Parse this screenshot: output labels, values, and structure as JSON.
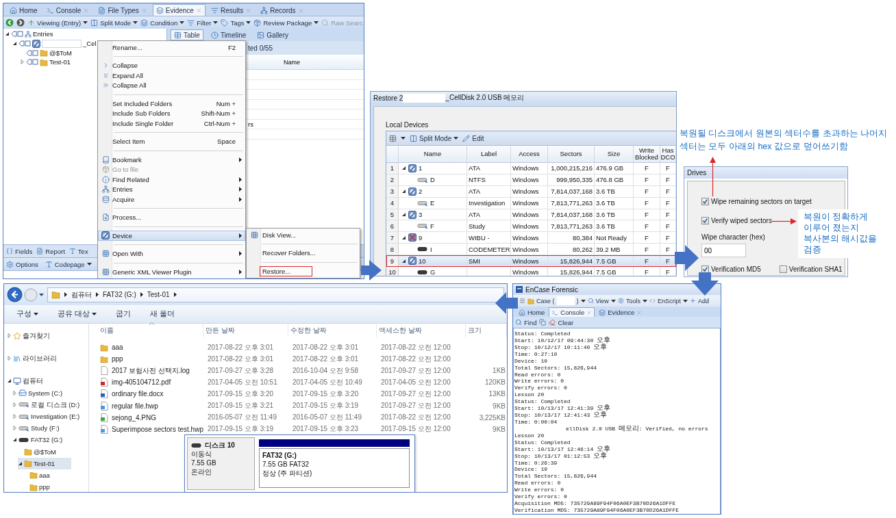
{
  "encase_window": {
    "tabs": [
      {
        "label": "Home",
        "selected": false,
        "closable": false
      },
      {
        "label": "Console",
        "selected": false,
        "closable": true
      },
      {
        "label": "File Types",
        "selected": false,
        "closable": true
      },
      {
        "label": "Evidence",
        "selected": true,
        "closable": true
      },
      {
        "label": "Results",
        "selected": false,
        "closable": true
      },
      {
        "label": "Records",
        "selected": false,
        "closable": true
      }
    ],
    "toolbar": [
      {
        "label": "Viewing (Entry)",
        "dropdown": true,
        "disabled": false
      },
      {
        "label": "Split Mode",
        "dropdown": true,
        "disabled": false
      },
      {
        "label": "Condition",
        "dropdown": true,
        "disabled": false
      },
      {
        "label": "Filter",
        "dropdown": true,
        "disabled": false
      },
      {
        "label": "Tags",
        "dropdown": true,
        "disabled": false
      },
      {
        "label": "Review Package",
        "dropdown": true,
        "disabled": false
      },
      {
        "label": "Raw Searc",
        "dropdown": false,
        "disabled": true
      }
    ],
    "tree": [
      {
        "label": "Entries",
        "kind": "root",
        "expandable": true,
        "expanded": true,
        "redacted": false,
        "children": [
          {
            "label": "_Cel",
            "kind": "device",
            "expandable": true,
            "expanded": true,
            "redacted": true,
            "children": [
              {
                "label": "@$ToM",
                "kind": "folder",
                "expandable": false,
                "redacted": false
              },
              {
                "label": "Test-01",
                "kind": "folder",
                "expandable": true,
                "expanded": false,
                "redacted": false
              }
            ]
          }
        ]
      }
    ],
    "view_tabs": [
      {
        "label": "Table",
        "selected": true
      },
      {
        "label": "Timeline",
        "selected": false
      },
      {
        "label": "Gallery",
        "selected": false
      }
    ],
    "status_fragment": "ted 0/55",
    "column_header": "Name",
    "cell_fragment": "rs",
    "bottom_tabs": [
      {
        "label": "Fields"
      },
      {
        "label": "Report"
      },
      {
        "label": "Tex"
      }
    ],
    "bottom_toolbar": [
      {
        "label": "Options",
        "dropdown": false
      },
      {
        "label": "Codepage",
        "dropdown": true
      }
    ],
    "context_menu": [
      {
        "kind": "item",
        "label": "Rename...",
        "shortcut": "F2",
        "submenu": false,
        "disabled": false,
        "selected": false
      },
      {
        "kind": "separator"
      },
      {
        "kind": "item",
        "label": "Collapse",
        "submenu": false,
        "disabled": false,
        "selected": false
      },
      {
        "kind": "item",
        "label": "Expand All",
        "submenu": false,
        "disabled": false,
        "selected": false
      },
      {
        "kind": "item",
        "label": "Collapse All",
        "submenu": false,
        "disabled": false,
        "selected": false
      },
      {
        "kind": "separator"
      },
      {
        "kind": "item",
        "label": "Set Included Folders",
        "shortcut": "Num +",
        "submenu": false,
        "disabled": false,
        "selected": false
      },
      {
        "kind": "item",
        "label": "Include Sub Folders",
        "shortcut": "Shift-Num +",
        "submenu": false,
        "disabled": false,
        "selected": false
      },
      {
        "kind": "item",
        "label": "Include Single Folder",
        "shortcut": "Ctrl-Num +",
        "submenu": false,
        "disabled": false,
        "selected": false
      },
      {
        "kind": "separator"
      },
      {
        "kind": "item",
        "label": "Select Item",
        "shortcut": "Space",
        "submenu": false,
        "disabled": false,
        "selected": false
      },
      {
        "kind": "separator"
      },
      {
        "kind": "item",
        "label": "Bookmark",
        "submenu": true,
        "disabled": false,
        "selected": false
      },
      {
        "kind": "item",
        "label": "Go to file",
        "submenu": false,
        "disabled": true,
        "selected": false
      },
      {
        "kind": "item",
        "label": "Find Related",
        "submenu": true,
        "disabled": false,
        "selected": false
      },
      {
        "kind": "item",
        "label": "Entries",
        "submenu": true,
        "disabled": false,
        "selected": false
      },
      {
        "kind": "item",
        "label": "Acquire",
        "submenu": true,
        "disabled": false,
        "selected": false
      },
      {
        "kind": "separator"
      },
      {
        "kind": "item",
        "label": "Process...",
        "submenu": false,
        "disabled": false,
        "selected": false
      },
      {
        "kind": "separator"
      },
      {
        "kind": "item",
        "label": "Device",
        "submenu": true,
        "disabled": false,
        "selected": true
      },
      {
        "kind": "separator"
      },
      {
        "kind": "item",
        "label": "Open With",
        "submenu": true,
        "disabled": false,
        "selected": false
      },
      {
        "kind": "separator"
      },
      {
        "kind": "item",
        "label": "Generic XML Viewer Plugin",
        "submenu": true,
        "disabled": false,
        "selected": false
      }
    ],
    "submenu": [
      {
        "kind": "item",
        "label": "Disk View...",
        "marked": false
      },
      {
        "kind": "separator"
      },
      {
        "kind": "item",
        "label": "Recover Folders...",
        "marked": false
      },
      {
        "kind": "separator"
      },
      {
        "kind": "item",
        "label": "Restore...",
        "marked": true
      }
    ]
  },
  "restore_dialog": {
    "title": "Restore 2",
    "title_suffix": "_CellDisk 2.0 USB 메모리",
    "section": "Local Devices",
    "toolbar": [
      {
        "label": "Split Mode",
        "dropdown": true
      },
      {
        "label": "Edit",
        "dropdown": false
      }
    ],
    "columns": [
      "Name",
      "Label",
      "Access",
      "Sectors",
      "Size",
      "Write Blocked",
      "Has DCO"
    ],
    "rows": [
      {
        "index": "1",
        "name": "1",
        "kind": "disk",
        "expandable": true,
        "label": "ATA",
        "access": "Windows",
        "sectors": "1,000,215,216",
        "size": "476.9 GB",
        "write_blocked": "F",
        "has_dco": "F",
        "selected": false
      },
      {
        "index": "2",
        "name": "D",
        "kind": "volume",
        "expandable": false,
        "label": "NTFS",
        "access": "Windows",
        "sectors": "999,950,335",
        "size": "476.8 GB",
        "write_blocked": "F",
        "has_dco": "F",
        "selected": false
      },
      {
        "index": "3",
        "name": "2",
        "kind": "disk",
        "expandable": true,
        "label": "ATA",
        "access": "Windows",
        "sectors": "7,814,037,168",
        "size": "3.6 TB",
        "write_blocked": "F",
        "has_dco": "F",
        "selected": false
      },
      {
        "index": "4",
        "name": "E",
        "kind": "volume",
        "expandable": false,
        "label": "Investigation",
        "access": "Windows",
        "sectors": "7,813,771,263",
        "size": "3.6 TB",
        "write_blocked": "F",
        "has_dco": "F",
        "selected": false
      },
      {
        "index": "5",
        "name": "3",
        "kind": "disk",
        "expandable": true,
        "label": "ATA",
        "access": "Windows",
        "sectors": "7,814,037,168",
        "size": "3.6 TB",
        "write_blocked": "F",
        "has_dco": "F",
        "selected": false
      },
      {
        "index": "6",
        "name": "F",
        "kind": "volume",
        "expandable": false,
        "label": "Study",
        "access": "Windows",
        "sectors": "7,813,771,263",
        "size": "3.6 TB",
        "write_blocked": "F",
        "has_dco": "F",
        "selected": false
      },
      {
        "index": "7",
        "name": "9",
        "kind": "error_disk",
        "expandable": true,
        "label": "WIBU -",
        "access": "Windows",
        "sectors": "80,384",
        "size": "Not Ready",
        "write_blocked": "F",
        "has_dco": "F",
        "selected": false
      },
      {
        "index": "8",
        "name": "I",
        "kind": "removable",
        "expandable": false,
        "label": "CODEMETER",
        "access": "Windows",
        "sectors": "80,262",
        "size": "39.2 MB",
        "write_blocked": "F",
        "has_dco": "F",
        "selected": false
      },
      {
        "index": "9",
        "name": "10",
        "kind": "disk",
        "expandable": true,
        "label": "SMI",
        "access": "Windows",
        "sectors": "15,826,944",
        "size": "7.5 GB",
        "write_blocked": "F",
        "has_dco": "F",
        "selected": true
      },
      {
        "index": "10",
        "name": "G",
        "kind": "removable",
        "expandable": false,
        "access": "Windows",
        "sectors": "15,826,944",
        "size": "7.5 GB",
        "write_blocked": "F",
        "has_dco": "F",
        "selected": false
      }
    ]
  },
  "drives_panel": {
    "title": "Drives",
    "options": [
      {
        "label": "Wipe remaining sectors on target",
        "checked": true
      },
      {
        "label": "Verify wiped sectors",
        "checked": true
      }
    ],
    "wipe_label": "Wipe character (hex)",
    "wipe_value": "00",
    "verifications": [
      {
        "label": "Verification MD5",
        "checked": true
      },
      {
        "label": "Verification SHA1",
        "checked": false
      }
    ]
  },
  "annotations": [
    {
      "text": "복원될 디스크에서 원본의 섹터수를 초과하는 나머지 섹터는 모두 아래의 hex 값으로 덮어쓰기함"
    },
    {
      "text": "복원이 정확하게 이루어 졌는지 복사본의 해시값을 검증"
    }
  ],
  "explorer": {
    "breadcrumbs": [
      "컴퓨터",
      "FAT32 (G:)",
      "Test-01"
    ],
    "toolbar": [
      {
        "label": "구성",
        "dropdown": true
      },
      {
        "label": "공유 대상",
        "dropdown": true
      },
      {
        "label": "굽기",
        "dropdown": false
      },
      {
        "label": "새 폴더",
        "dropdown": false
      }
    ],
    "nav": [
      {
        "label": "즐겨찾기",
        "kind": "favorites",
        "expandable": true,
        "expanded": false,
        "selected": false
      },
      {
        "label": "라이브러리",
        "kind": "library",
        "expandable": true,
        "expanded": false,
        "selected": false
      },
      {
        "label": "컴퓨터",
        "kind": "computer",
        "expandable": true,
        "expanded": true,
        "selected": false,
        "children": [
          {
            "label": "System (C:)",
            "kind": "system_drive",
            "expandable": true,
            "expanded": false,
            "selected": false
          },
          {
            "label": "로컬 디스크 (D:)",
            "kind": "drive",
            "expandable": true,
            "expanded": false,
            "selected": false
          },
          {
            "label": "Investigation (E:)",
            "kind": "drive",
            "expandable": true,
            "expanded": false,
            "selected": false
          },
          {
            "label": "Study (F:)",
            "kind": "drive",
            "expandable": true,
            "expanded": false,
            "selected": false
          },
          {
            "label": "FAT32 (G:)",
            "kind": "removable",
            "expandable": true,
            "expanded": true,
            "selected": false,
            "children": [
              {
                "label": "@$ToM",
                "kind": "folder",
                "expandable": false,
                "selected": false
              },
              {
                "label": "Test-01",
                "kind": "folder",
                "expandable": true,
                "expanded": true,
                "selected": true,
                "children": [
                  {
                    "label": "aaa",
                    "kind": "folder",
                    "expandable": false,
                    "selected": false
                  },
                  {
                    "label": "ppp",
                    "kind": "folder",
                    "expandable": false,
                    "selected": false
                  }
                ]
              }
            ]
          }
        ]
      }
    ],
    "columns": [
      "이름",
      "만든 날짜",
      "수정한 날짜",
      "액세스한 날짜",
      "크기"
    ],
    "files": [
      {
        "name": "aaa",
        "kind": "folder",
        "created": "2017-08-22 오후 3:01",
        "modified": "2017-08-22 오후 3:01",
        "accessed": "2017-08-22 오전 12:00"
      },
      {
        "name": "ppp",
        "kind": "folder",
        "created": "2017-08-22 오후 3:01",
        "modified": "2017-08-22 오후 3:01",
        "accessed": "2017-08-22 오전 12:00"
      },
      {
        "name": "2017 보험사전 선택지.log",
        "kind": "log",
        "created": "2017-09-27 오후 3:28",
        "modified": "2016-10-04 오전 9:58",
        "accessed": "2017-09-27 오전 12:00",
        "size": "1KB"
      },
      {
        "name": "img-405104712.pdf",
        "kind": "pdf",
        "created": "2017-04-05 오전 10:51",
        "modified": "2017-04-05 오전 10:49",
        "accessed": "2017-04-05 오전 12:00",
        "size": "120KB"
      },
      {
        "name": "ordinary file.docx",
        "kind": "docx",
        "created": "2017-09-15 오후 3:20",
        "modified": "2017-09-15 오후 3:20",
        "accessed": "2017-09-27 오전 12:00",
        "size": "13KB"
      },
      {
        "name": "regular file.hwp",
        "kind": "hwp",
        "created": "2017-09-15 오후 3:21",
        "modified": "2017-09-15 오후 3:19",
        "accessed": "2017-09-27 오전 12:00",
        "size": "9KB"
      },
      {
        "name": "sejong_4.PNG",
        "kind": "png",
        "created": "2016-05-07 오전 11:49",
        "modified": "2016-05-07 오전 11:49",
        "accessed": "2017-08-22 오전 12:00",
        "size": "3,225KB"
      },
      {
        "name": "Superimpose sectors test.hwp",
        "kind": "hwp",
        "created": "2017-09-15 오후 3:19",
        "modified": "2017-09-15 오후 3:23",
        "accessed": "2017-09-15 오전 12:00",
        "size": "9KB"
      }
    ],
    "disk_popup": {
      "disk_name": "디스크 10",
      "disk_lines": [
        "이동식",
        "7.55 GB",
        "온라인"
      ],
      "partition_name": "FAT32  (G:)",
      "partition_lines": [
        "7.55 GB FAT32",
        "정상 (주 파티션)"
      ]
    }
  },
  "console_window": {
    "title": "EnCase Forensic",
    "toolbar": [
      {
        "label": "Case (",
        "dropdown": true,
        "suffix": ")"
      },
      {
        "label": "View",
        "dropdown": true
      },
      {
        "label": "Tools",
        "dropdown": true
      },
      {
        "label": "EnScript",
        "dropdown": true
      },
      {
        "label": "Add",
        "dropdown": false
      }
    ],
    "tabs": [
      {
        "label": "Home",
        "selected": false,
        "closable": false
      },
      {
        "label": "Console",
        "selected": true,
        "closable": true
      },
      {
        "label": "Evidence",
        "selected": false,
        "closable": true
      }
    ],
    "tools": [
      "Find",
      "Clear"
    ],
    "lines": [
      {
        "text": "Status: Completed",
        "redacted": false
      },
      {
        "text": "Start: 10/12/17 09:44:30 오후",
        "redacted": false
      },
      {
        "text": "Stop: 10/12/17 10:11:40 오후",
        "redacted": false
      },
      {
        "text": "Time: 0:27:10",
        "redacted": false
      },
      {
        "text": "Device: 10",
        "redacted": false
      },
      {
        "text": "Total Sectors: 15,826,944",
        "redacted": false
      },
      {
        "text": "Read errors: 0",
        "redacted": false
      },
      {
        "text": "Write errors: 0",
        "redacted": false
      },
      {
        "text": "Verify errors: 0",
        "redacted": false
      },
      {
        "text": "Lesson 20",
        "redacted": false
      },
      {
        "text": "Status: Completed",
        "redacted": false
      },
      {
        "text": "Start: 10/13/17 12:41:39 오후",
        "redacted": false
      },
      {
        "text": "Stop: 10/13/17 12:41:43 오후",
        "redacted": false
      },
      {
        "text": "Time: 0:00:04",
        "redacted": false
      },
      {
        "text": "ellDisk 2.0 USB 메모리: Verified, no errors",
        "redacted": true
      },
      {
        "text": "Lesson 20",
        "redacted": false
      },
      {
        "text": "Status: Completed",
        "redacted": false
      },
      {
        "text": "Start: 10/13/17 12:46:14 오후",
        "redacted": false
      },
      {
        "text": "Stop: 10/13/17 01:12:53 오후",
        "redacted": false
      },
      {
        "text": "Time: 0:26:39",
        "redacted": false
      },
      {
        "text": "Device: 10",
        "redacted": false
      },
      {
        "text": "Total Sectors: 15,826,944",
        "redacted": false
      },
      {
        "text": "Read errors: 0",
        "redacted": false
      },
      {
        "text": "Write errors: 0",
        "redacted": false
      },
      {
        "text": "Verify errors: 0",
        "redacted": false
      },
      {
        "text": "Acquisition MD5: 735729A89F94F06A0EF3B70D26A1DFFE",
        "redacted": false
      },
      {
        "text": "Verification MD5: 735729A89F94F06A0EF3B70D26A1DFFE",
        "redacted": false
      }
    ]
  }
}
